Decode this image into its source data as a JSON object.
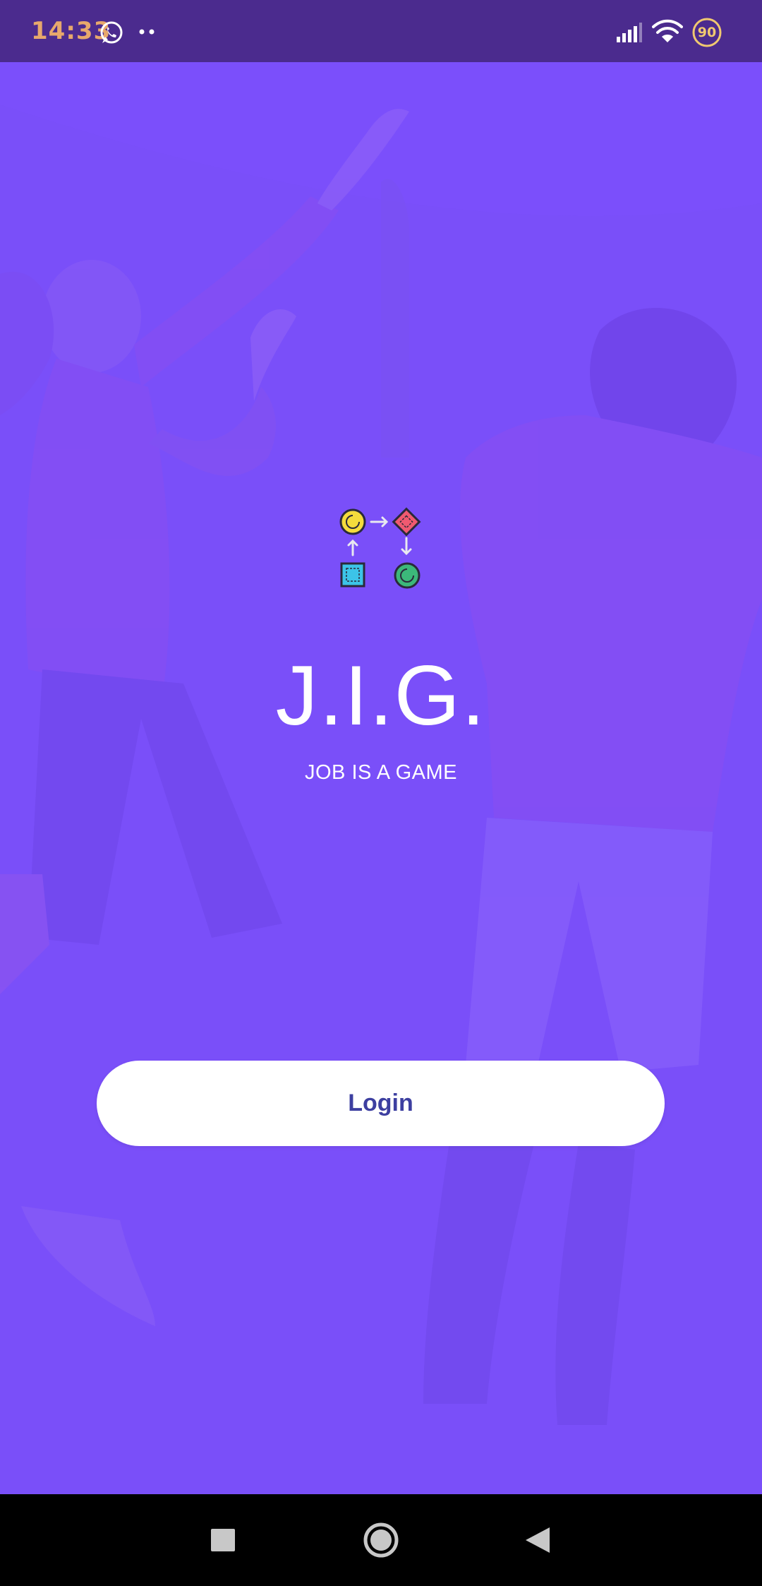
{
  "status_bar": {
    "time": "14:33",
    "icons": [
      "whatsapp-icon",
      "more-dots-icon",
      "signal-icon",
      "wifi-icon",
      "battery-icon"
    ],
    "battery_level": "90"
  },
  "app": {
    "title": "J.I.G.",
    "subtitle": "JOB IS A GAME",
    "logo_icon": "workflow-shapes-icon"
  },
  "actions": {
    "login_label": "Login"
  },
  "nav_bar": {
    "icons": [
      "recents-square-icon",
      "home-circle-icon",
      "back-triangle-icon"
    ]
  },
  "colors": {
    "background": "#7b4ffb",
    "status_bar": "#4b2b8e",
    "button_text": "#3d3fa0",
    "status_text": "#e7a86c"
  }
}
